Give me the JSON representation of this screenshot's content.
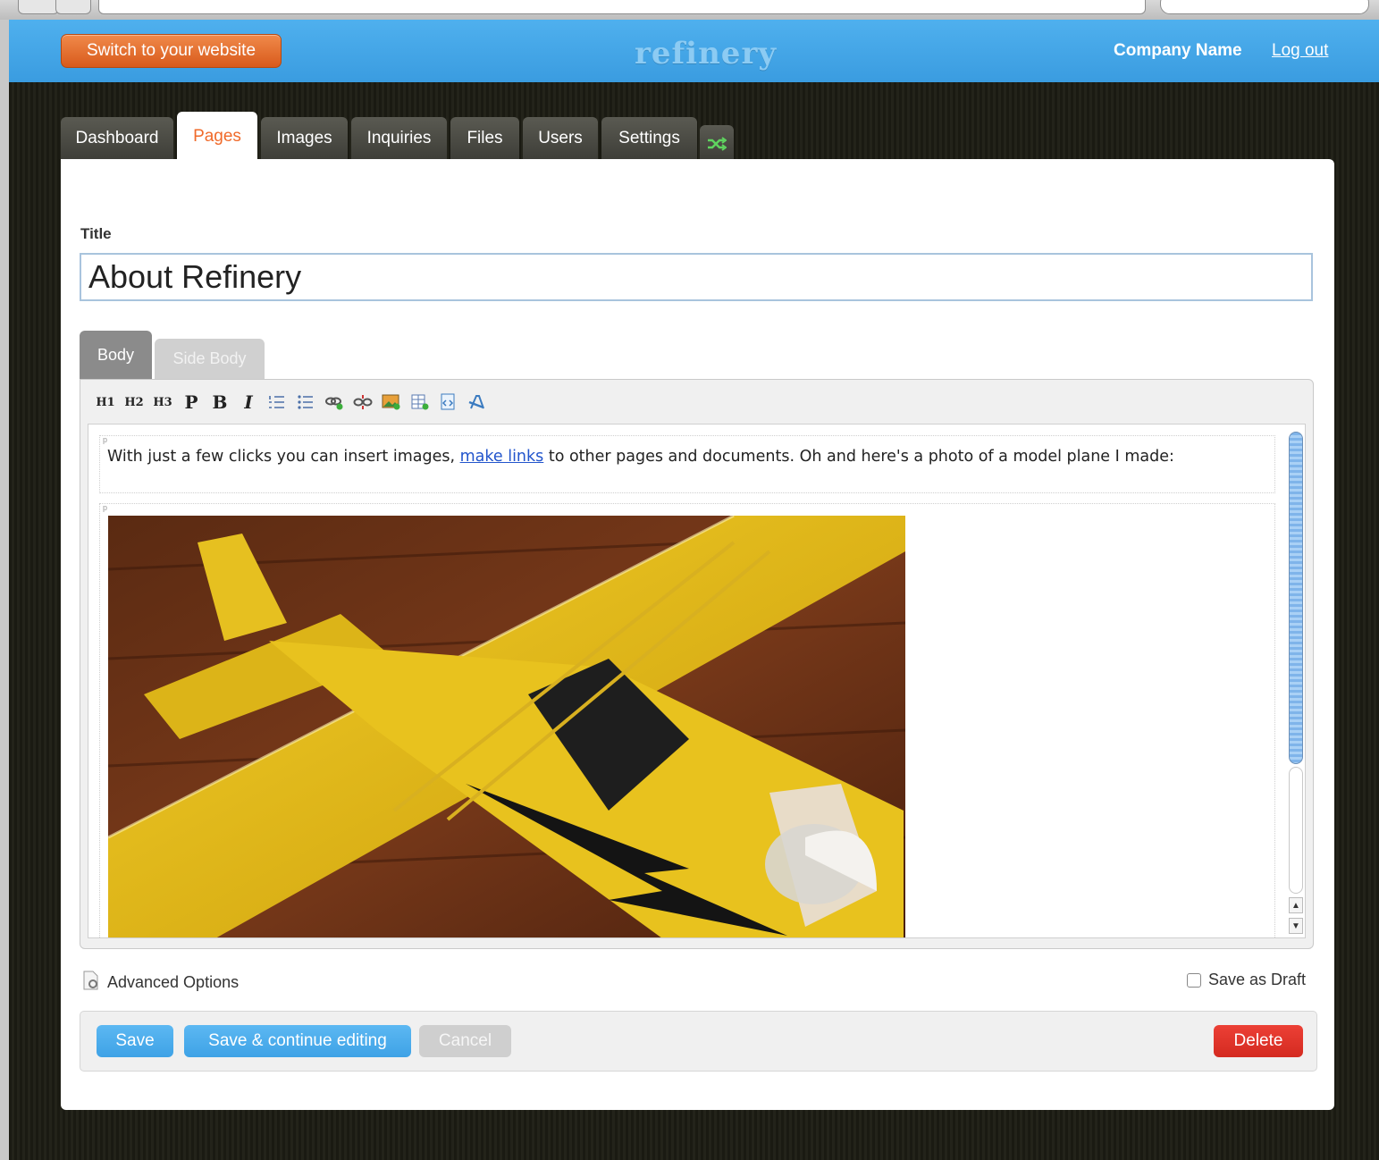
{
  "header": {
    "switch_label": "Switch to your website",
    "logo": "refinery",
    "company": "Company Name",
    "logout": "Log out"
  },
  "tabs": [
    {
      "label": "Dashboard"
    },
    {
      "label": "Pages",
      "active": true
    },
    {
      "label": "Images"
    },
    {
      "label": "Inquiries"
    },
    {
      "label": "Files"
    },
    {
      "label": "Users"
    },
    {
      "label": "Settings"
    },
    {
      "icon": "shuffle-icon"
    }
  ],
  "form": {
    "title_label": "Title",
    "title_value": "About Refinery",
    "body_tabs": [
      {
        "label": "Body",
        "active": true
      },
      {
        "label": "Side Body"
      }
    ],
    "toolbar": [
      {
        "label": "H1"
      },
      {
        "label": "H2"
      },
      {
        "label": "H3"
      },
      {
        "label": "P"
      },
      {
        "label": "B"
      },
      {
        "label": "I"
      },
      {
        "icon": "ordered-list-icon"
      },
      {
        "icon": "unordered-list-icon"
      },
      {
        "icon": "insert-link-icon"
      },
      {
        "icon": "unlink-icon"
      },
      {
        "icon": "insert-image-icon"
      },
      {
        "icon": "insert-table-icon"
      },
      {
        "icon": "html-source-icon"
      },
      {
        "icon": "clean-format-icon"
      }
    ],
    "body_text_before": "With just a few clicks you can insert images, ",
    "body_link": "make links",
    "body_text_after": " to other pages and documents. Oh and here's a photo of a model plane I made:",
    "advanced_options": "Advanced Options",
    "save_as_draft": "Save as Draft"
  },
  "actions": {
    "save": "Save",
    "save_continue": "Save & continue editing",
    "cancel": "Cancel",
    "delete": "Delete"
  },
  "colors": {
    "header_blue": "#3ea2e6",
    "accent_orange": "#f06a2a",
    "delete_red": "#d42a20"
  }
}
